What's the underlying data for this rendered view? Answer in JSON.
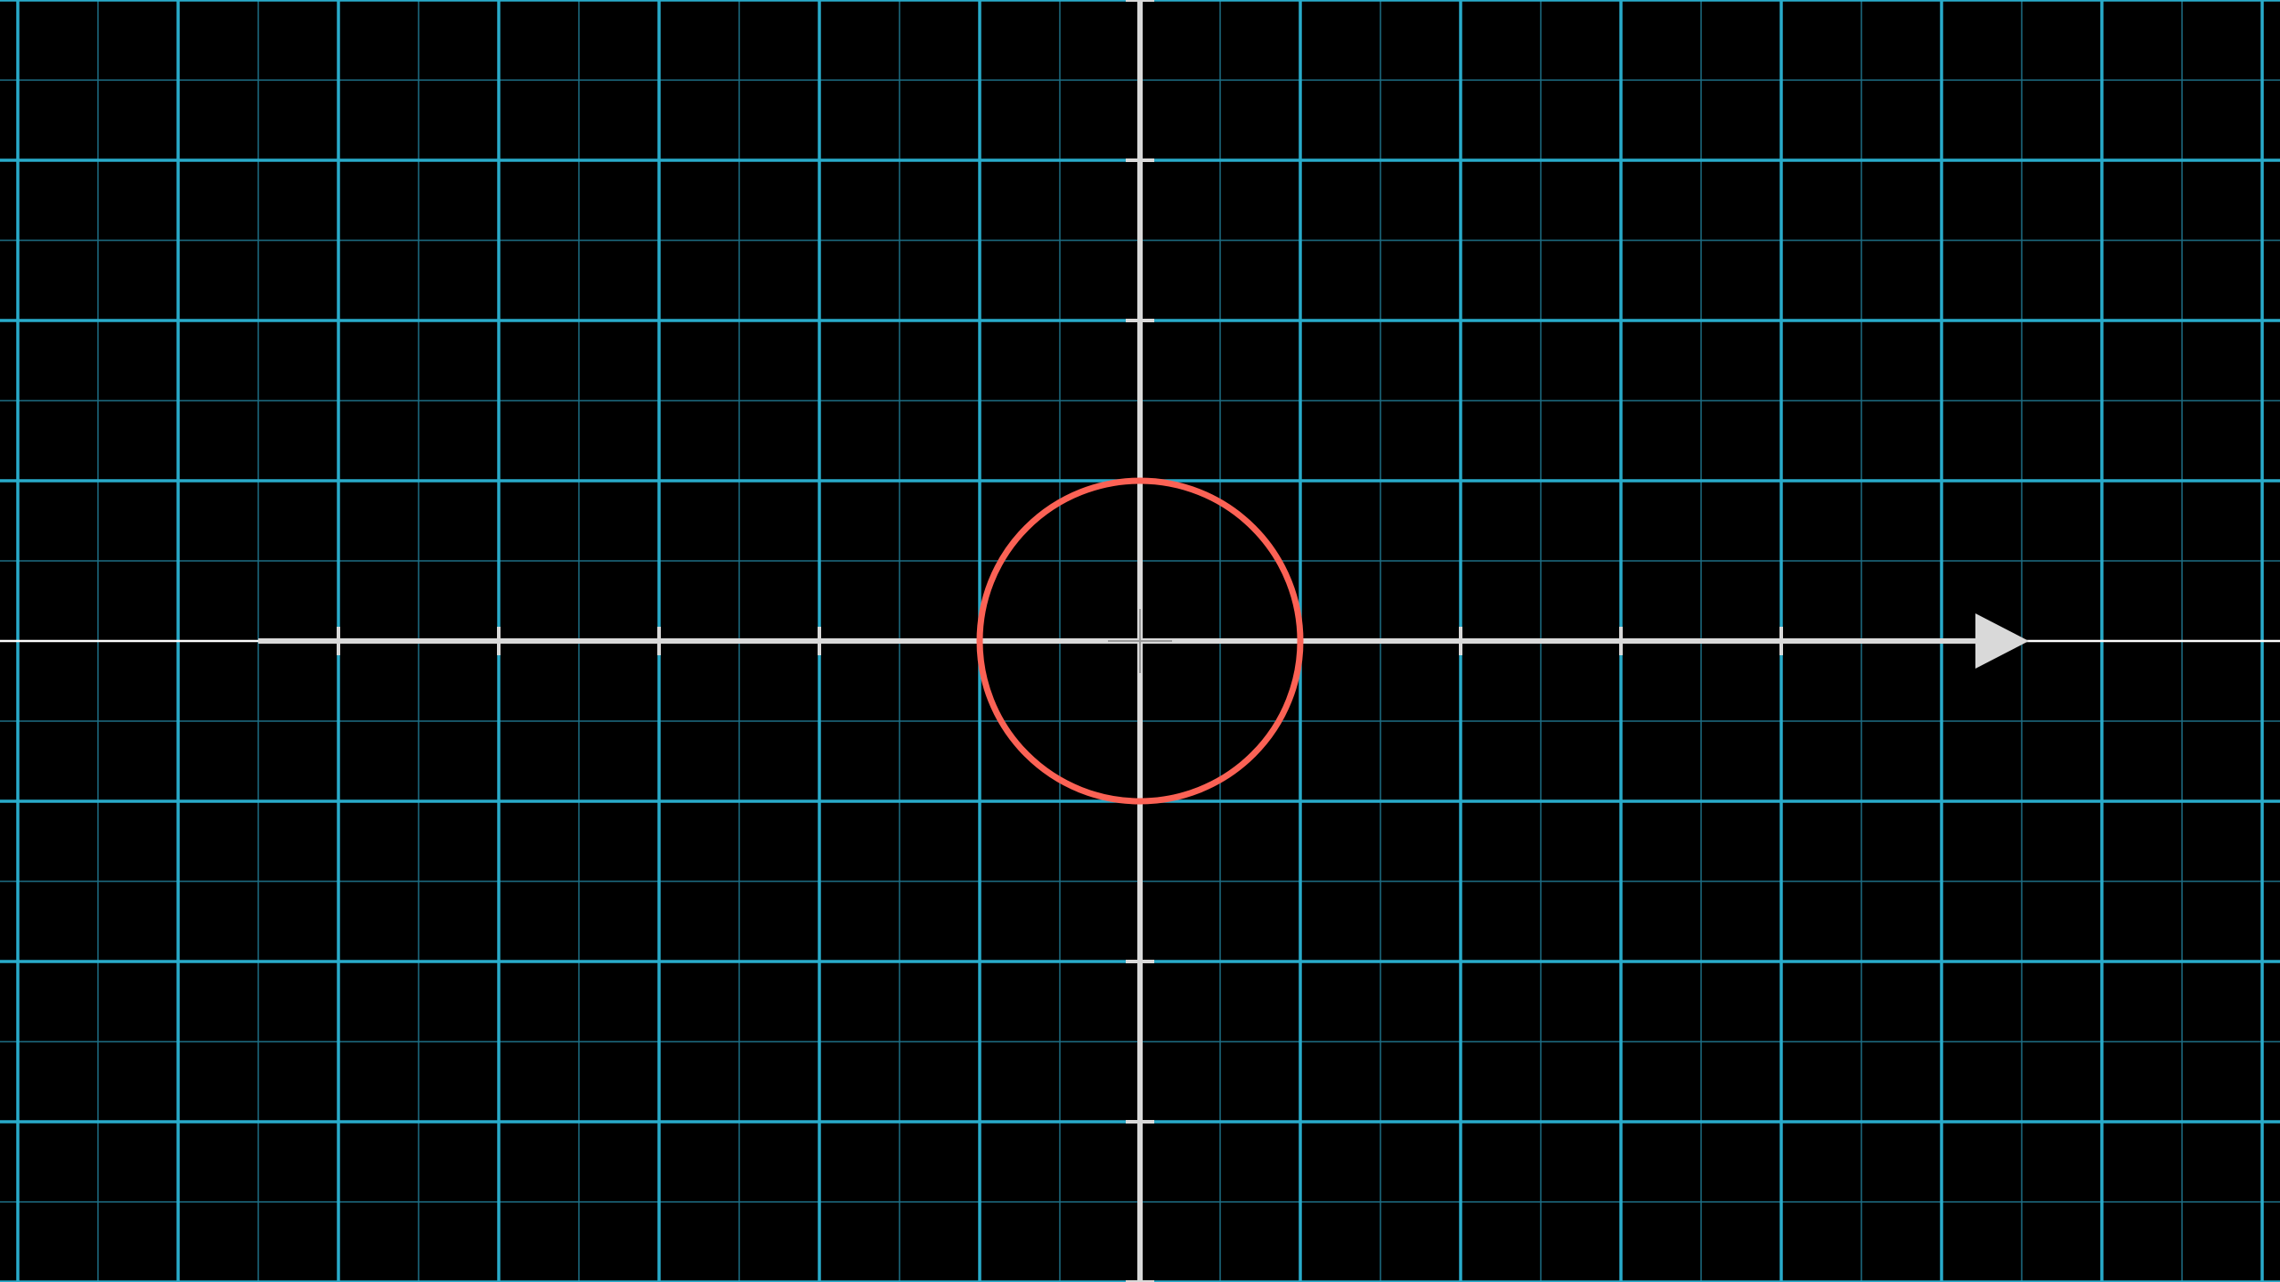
{
  "diagram": {
    "type": "coordinate-plane",
    "grid": {
      "major_step": 1,
      "minor_subdivisions": 2,
      "major_color": "#29abca",
      "minor_color": "#1e6f85",
      "x_range": [
        -7,
        7
      ],
      "y_range": [
        -4,
        4
      ]
    },
    "axes": {
      "color": "#d9d9d9",
      "x_axis": {
        "range": [
          -5.5,
          5.5
        ],
        "tick_positions": [
          -5,
          -4,
          -3,
          -2,
          2,
          3,
          4
        ],
        "arrow": "positive"
      },
      "y_axis": {
        "range": [
          -4,
          4
        ],
        "tick_positions": [
          -4,
          -3,
          -2,
          -1,
          2,
          3,
          4
        ]
      }
    },
    "circle": {
      "center": [
        0,
        0
      ],
      "radius": 1,
      "color": "#fc6255"
    }
  }
}
